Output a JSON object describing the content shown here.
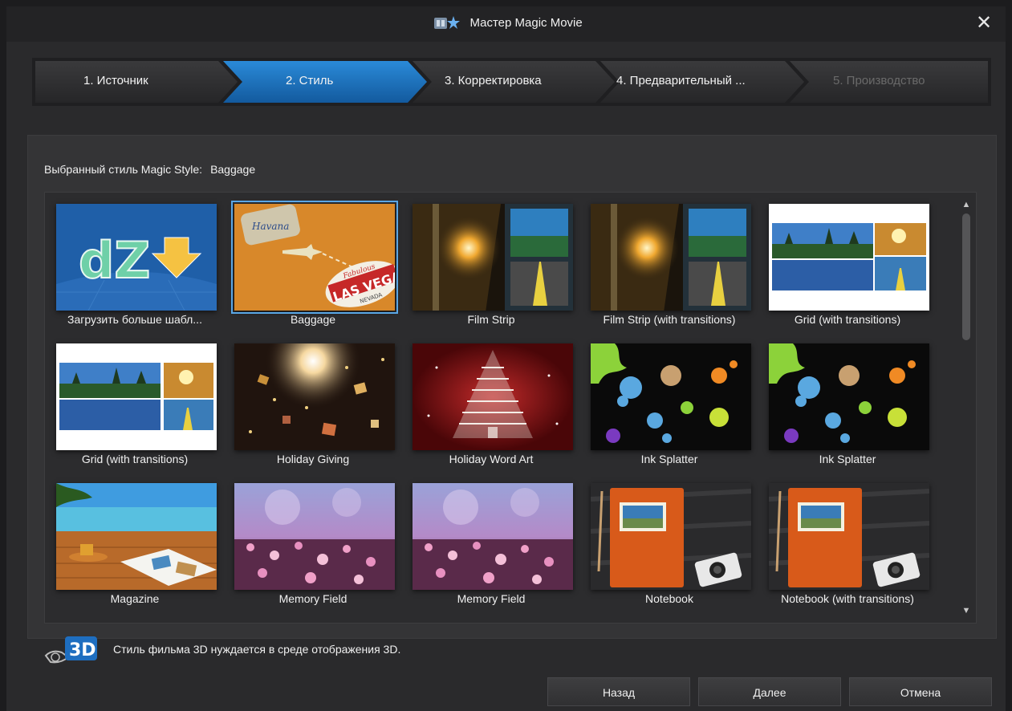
{
  "window": {
    "title": "Мастер Magic Movie",
    "title_icon": "magic-movie-wizard-icon",
    "close_icon": "close-icon"
  },
  "steps": [
    {
      "label": "1. Источник",
      "state": "done"
    },
    {
      "label": "2. Стиль",
      "state": "active"
    },
    {
      "label": "3. Корректировка",
      "state": "upcoming"
    },
    {
      "label": "4. Предварительный ...",
      "state": "upcoming"
    },
    {
      "label": "5. Производство",
      "state": "disabled"
    }
  ],
  "colors": {
    "active_step": "#1e78c8",
    "selection_outline": "#5aa7e6",
    "background": "#2a2a2c"
  },
  "selected_style": {
    "label": "Выбранный стиль Magic Style:",
    "value": "Baggage"
  },
  "styles": [
    {
      "label": "Загрузить больше шабл...",
      "thumb": "download-more-templates-icon"
    },
    {
      "label": "Baggage",
      "thumb": "baggage-thumbnail",
      "selected": true
    },
    {
      "label": "Film Strip",
      "thumb": "film-strip-thumbnail"
    },
    {
      "label": "Film Strip (with transitions)",
      "thumb": "film-strip-thumbnail"
    },
    {
      "label": "Grid (with transitions)",
      "thumb": "grid-thumbnail"
    },
    {
      "label": "Grid (with transitions)",
      "thumb": "grid-thumbnail"
    },
    {
      "label": "Holiday Giving",
      "thumb": "holiday-giving-thumbnail"
    },
    {
      "label": "Holiday Word Art",
      "thumb": "holiday-word-art-thumbnail"
    },
    {
      "label": "Ink Splatter",
      "thumb": "ink-splatter-thumbnail"
    },
    {
      "label": "Ink Splatter",
      "thumb": "ink-splatter-thumbnail"
    },
    {
      "label": "Magazine",
      "thumb": "magazine-thumbnail"
    },
    {
      "label": "Memory Field",
      "thumb": "memory-field-thumbnail"
    },
    {
      "label": "Memory Field",
      "thumb": "memory-field-thumbnail"
    },
    {
      "label": "Notebook",
      "thumb": "notebook-thumbnail"
    },
    {
      "label": "Notebook (with transitions)",
      "thumb": "notebook-thumbnail"
    }
  ],
  "thumb_text": {
    "dz": "dZ",
    "havana": "Havana",
    "fabulous": "Fabulous",
    "las_vegas": "LAS VEGAS",
    "nevada": "NEVADA"
  },
  "info": {
    "icon_text": "3D",
    "text": "Стиль фильма 3D нуждается в среде отображения 3D."
  },
  "buttons": {
    "back": "Назад",
    "next": "Далее",
    "cancel": "Отмена"
  }
}
